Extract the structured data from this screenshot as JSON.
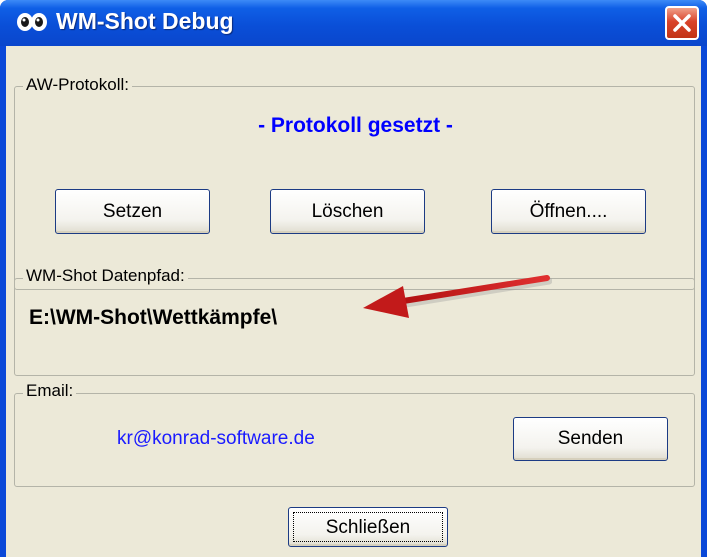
{
  "window": {
    "title": "WM-Shot Debug",
    "icon": "app-icon",
    "colors": {
      "titlebar": "#0a4fd8",
      "close": "#d9432a",
      "face": "#ece9d8"
    }
  },
  "aw_protokoll": {
    "legend": "AW-Protokoll:",
    "status": "- Protokoll gesetzt -",
    "buttons": {
      "set": "Setzen",
      "delete": "Löschen",
      "open": "Öffnen...."
    }
  },
  "datenpfad": {
    "legend": "WM-Shot Datenpfad:",
    "path": "E:\\WM-Shot\\Wettkämpfe\\"
  },
  "email": {
    "legend": "Email:",
    "address": "kr@konrad-software.de",
    "send": "Senden"
  },
  "footer": {
    "close": "Schließen"
  }
}
